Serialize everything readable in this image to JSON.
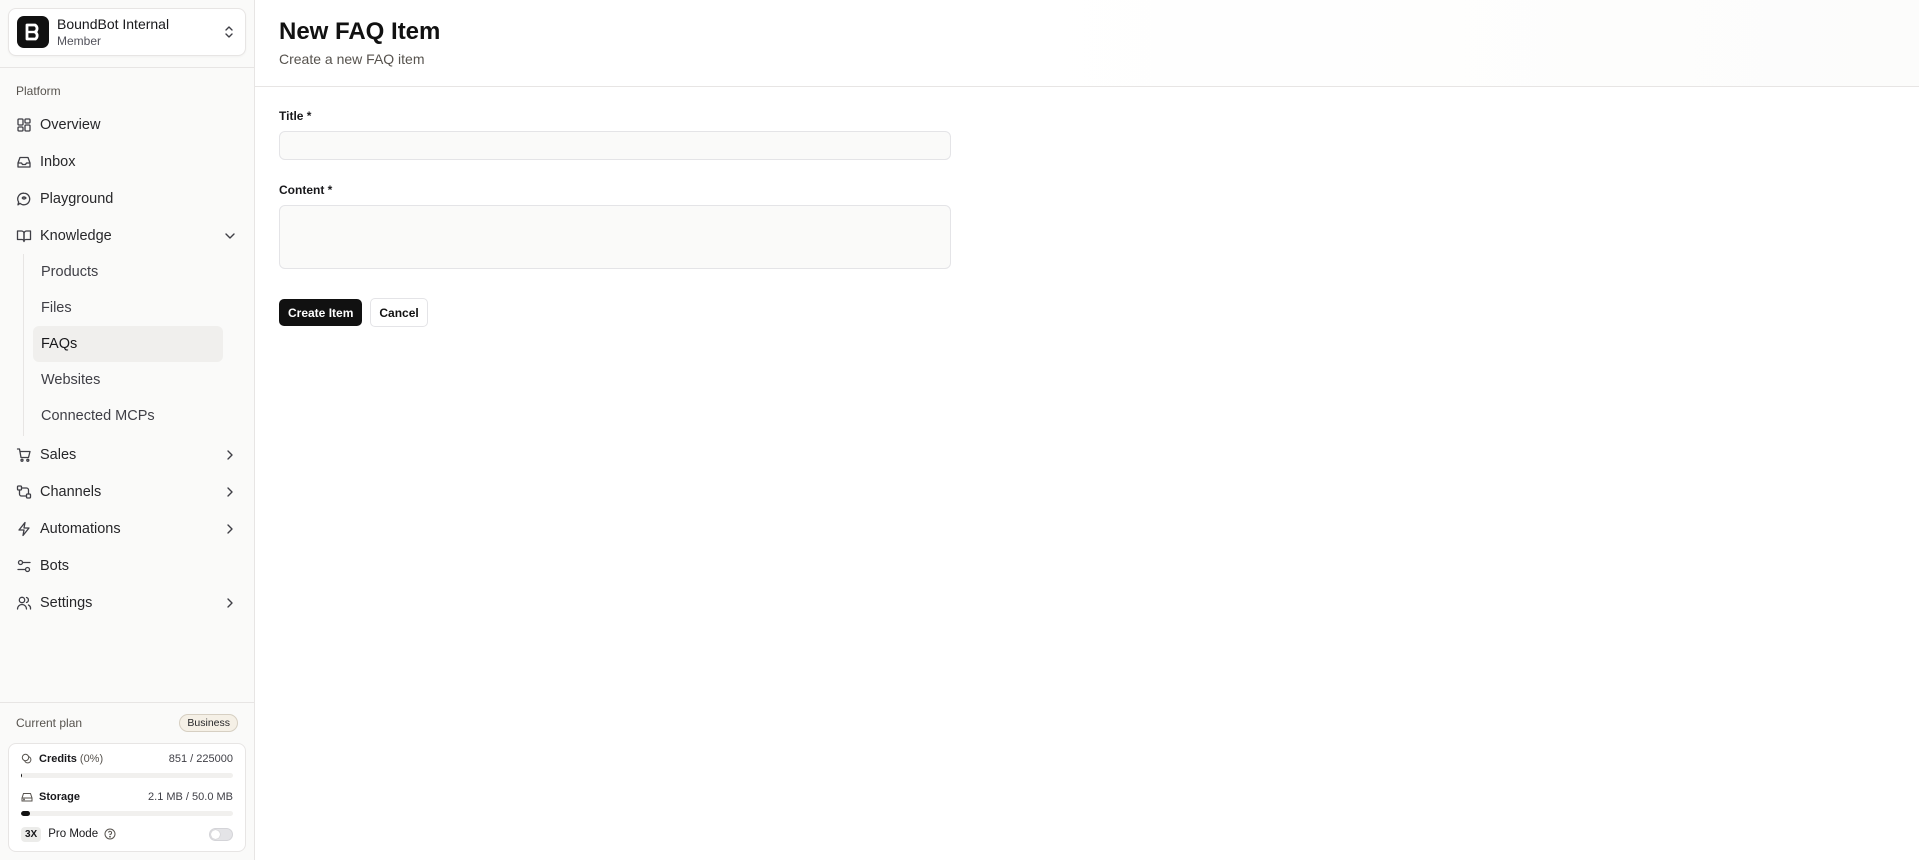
{
  "sidebar": {
    "org": {
      "name": "BoundBot Internal",
      "role": "Member"
    },
    "section_label": "Platform",
    "items": [
      {
        "label": "Overview"
      },
      {
        "label": "Inbox"
      },
      {
        "label": "Playground"
      },
      {
        "label": "Knowledge"
      },
      {
        "label": "Sales"
      },
      {
        "label": "Channels"
      },
      {
        "label": "Automations"
      },
      {
        "label": "Bots"
      },
      {
        "label": "Settings"
      }
    ],
    "knowledge_sub": [
      {
        "label": "Products"
      },
      {
        "label": "Files"
      },
      {
        "label": "FAQs"
      },
      {
        "label": "Websites"
      },
      {
        "label": "Connected MCPs"
      }
    ],
    "active_sub": "FAQs",
    "plan": {
      "label": "Current plan",
      "badge": "Business",
      "credits": {
        "name": "Credits",
        "pct": "(0%)",
        "value": "851 / 225000",
        "fill": 0.004
      },
      "storage": {
        "name": "Storage",
        "value": "2.1 MB / 50.0 MB",
        "fill": 0.042
      },
      "pro": {
        "badge": "3X",
        "label": "Pro Mode",
        "enabled": false
      }
    }
  },
  "header": {
    "title": "New FAQ Item",
    "subtitle": "Create a new FAQ item"
  },
  "form": {
    "title_label": "Title *",
    "title_value": "",
    "content_label": "Content *",
    "content_value": "",
    "submit_label": "Create Item",
    "cancel_label": "Cancel"
  },
  "colors": {
    "accent": "#111111",
    "sidebar_bg": "#fafaf9",
    "active_bg": "#f0efed",
    "border": "#e7e5e4"
  }
}
